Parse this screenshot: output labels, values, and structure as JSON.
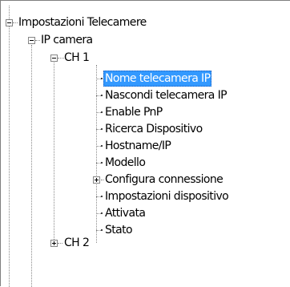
{
  "tree": {
    "root": {
      "label": "Impostazioni Telecamere",
      "state": "expanded"
    },
    "ip_camera": {
      "label": "IP camera",
      "state": "expanded"
    },
    "ch1": {
      "label": "CH 1",
      "state": "expanded"
    },
    "ch1_items": [
      {
        "label": "Nome telecamera IP",
        "selected": true
      },
      {
        "label": "Nascondi telecamera IP"
      },
      {
        "label": "Enable PnP"
      },
      {
        "label": "Ricerca Dispositivo"
      },
      {
        "label": "Hostname/IP"
      },
      {
        "label": "Modello"
      },
      {
        "label": "Configura connessione",
        "state": "collapsed"
      },
      {
        "label": "Impostazioni dispositivo"
      },
      {
        "label": "Attivata"
      },
      {
        "label": "Stato"
      }
    ],
    "ch2": {
      "label": "CH 2",
      "state": "collapsed"
    }
  },
  "colors": {
    "selection": "#3399ff",
    "selection_text": "#ffffff",
    "lines": "#8a8a8a"
  }
}
